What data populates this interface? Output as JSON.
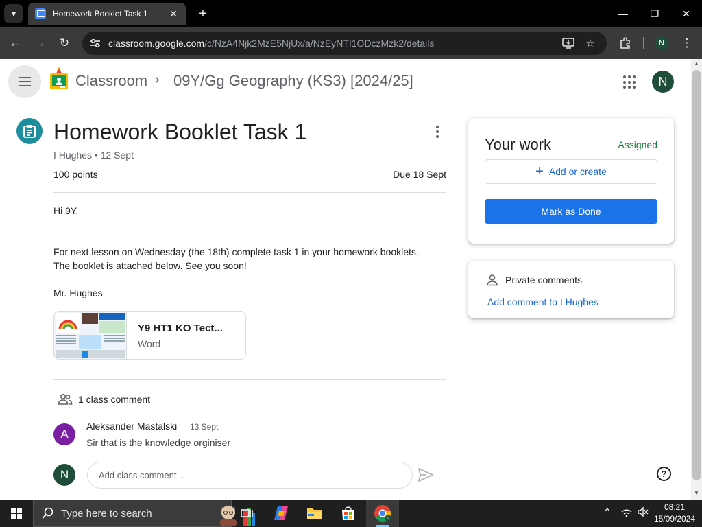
{
  "browser": {
    "tab_title": "Homework Booklet Task 1",
    "url_host": "classroom.google.com",
    "url_path": "/c/NzA4Njk2MzE5NjUx/a/NzEyNTI1ODczMzk2/details",
    "profile_initial": "N"
  },
  "header": {
    "app_name": "Classroom",
    "separator": "›",
    "class_name": "09Y/Gg Geography (KS3) [2024/25]",
    "avatar_initial": "N"
  },
  "assignment": {
    "title": "Homework Booklet Task 1",
    "meta": "I Hughes • 12 Sept",
    "points": "100 points",
    "due": "Due 18 Sept",
    "body": {
      "greeting": "Hi 9Y,",
      "line1": "For next lesson on Wednesday (the 18th) complete task 1 in your homework booklets.",
      "line2": "The booklet is attached below. See you soon!",
      "signoff": "Mr. Hughes"
    },
    "attachment": {
      "name": "Y9 HT1 KO Tect...",
      "type": "Word"
    }
  },
  "class_comments": {
    "count_label": "1 class comment",
    "items": [
      {
        "initial": "A",
        "author": "Aleksander Mastalski",
        "date": "13 Sept",
        "text": "Sir that is the knowledge orginiser",
        "avatar_color": "#7b1fa2"
      }
    ],
    "input_placeholder": "Add class comment...",
    "my_initial": "N"
  },
  "your_work": {
    "title": "Your work",
    "status": "Assigned",
    "add_label": "Add or create",
    "mark_done_label": "Mark as Done"
  },
  "private_comments": {
    "title": "Private comments",
    "add_label": "Add comment to I Hughes"
  },
  "help_symbol": "?",
  "taskbar": {
    "search_placeholder": "Type here to search",
    "time": "08:21",
    "date": "15/09/2024"
  },
  "colors": {
    "accent_blue": "#1a73e8",
    "link_blue": "#1967d2",
    "assigned_green": "#188038",
    "assignment_teal": "#1e8e9e",
    "profile_green": "#1e4d3a"
  }
}
